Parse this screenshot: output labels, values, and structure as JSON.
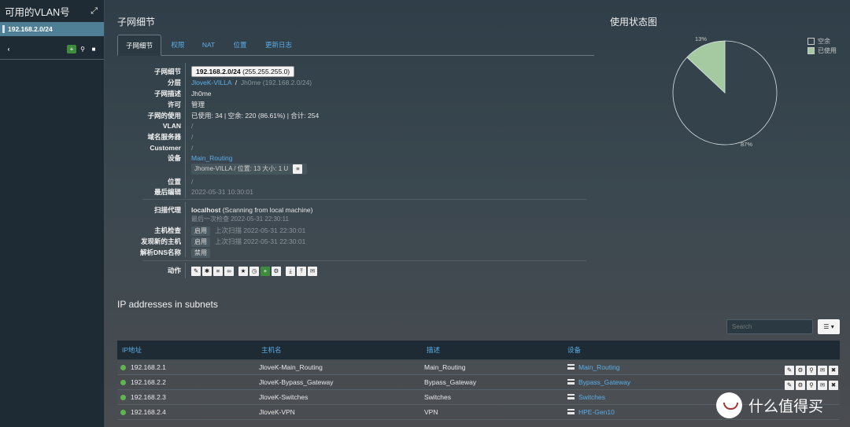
{
  "sidebar": {
    "title": "可用的VLAN号",
    "selected_subnet": "192.168.2.0/24"
  },
  "section_title": "子网细节",
  "tabs": [
    "子网细节",
    "权限",
    "NAT",
    "位置",
    "更新日志"
  ],
  "details": {
    "subnet_label": "子网细节",
    "subnet_value": "192.168.2.0/24",
    "subnet_mask": "(255.255.255.0)",
    "hierarchy_label": "分层",
    "hierarchy_link": "JloveK-VILLA",
    "hierarchy_sep": "/",
    "hierarchy_rest": "Jh0me (192.168.2.0/24)",
    "desc_label": "子网描述",
    "desc_value": "Jh0me",
    "permission_label": "许可",
    "permission_value": "管理",
    "usage_label": "子网的使用",
    "usage_value": "已使用: 34 | 空余: 220 (86.61%) | 合计: 254",
    "vlan_label": "VLAN",
    "vlan_value": "/",
    "dns_label": "域名服务器",
    "dns_value": "/",
    "customer_label": "Customer",
    "customer_value": "/",
    "device_label": "设备",
    "device_link": "Main_Routing",
    "device_location": "Jhome-VILLA / 位置: 13 大小: 1 U",
    "location_label": "位置",
    "location_value": "/",
    "lastedit_label": "最后编辑",
    "lastedit_value": "2022-05-31 10:30:01",
    "scan_label": "扫描代理",
    "scan_agent": "localhost",
    "scan_desc": "(Scanning from local machine)",
    "scan_last": "最后一次检查 2022-05-31 22:30:11",
    "hostcheck_label": "主机检查",
    "hostcheck_status": "启用",
    "hostcheck_time": "上次扫描 2022-05-31 22:30:01",
    "discover_label": "发现新的主机",
    "discover_status": "启用",
    "discover_time": "上次扫描 2022-05-31 22:30:01",
    "resolve_label": "解析DNS名称",
    "resolve_status": "禁用",
    "actions_label": "动作"
  },
  "ip_section_title": "IP addresses in subnets",
  "search_placeholder": "Search",
  "table": {
    "headers": [
      "IP地址",
      "主机名",
      "描述",
      "设备"
    ],
    "rows": [
      {
        "ip": "192.168.2.1",
        "host": "JloveK-Main_Routing",
        "desc": "Main_Routing",
        "device": "Main_Routing"
      },
      {
        "ip": "192.168.2.2",
        "host": "JloveK-Bypass_Gateway",
        "desc": "Bypass_Gateway",
        "device": "Bypass_Gateway"
      },
      {
        "ip": "192.168.2.3",
        "host": "JloveK-Switches",
        "desc": "Switches",
        "device": "Switches"
      },
      {
        "ip": "192.168.2.4",
        "host": "JloveK-VPN",
        "desc": "VPN",
        "device": "HPE-Gen10"
      }
    ]
  },
  "usage_chart": {
    "title": "使用状态图",
    "legend": [
      "空余",
      "已使用"
    ],
    "used_label": "13%",
    "free_label": "87%",
    "used_fraction": 0.13,
    "colors": {
      "free": "#34424c",
      "used": "#a5c9a0"
    }
  },
  "watermark": "什么值得买"
}
